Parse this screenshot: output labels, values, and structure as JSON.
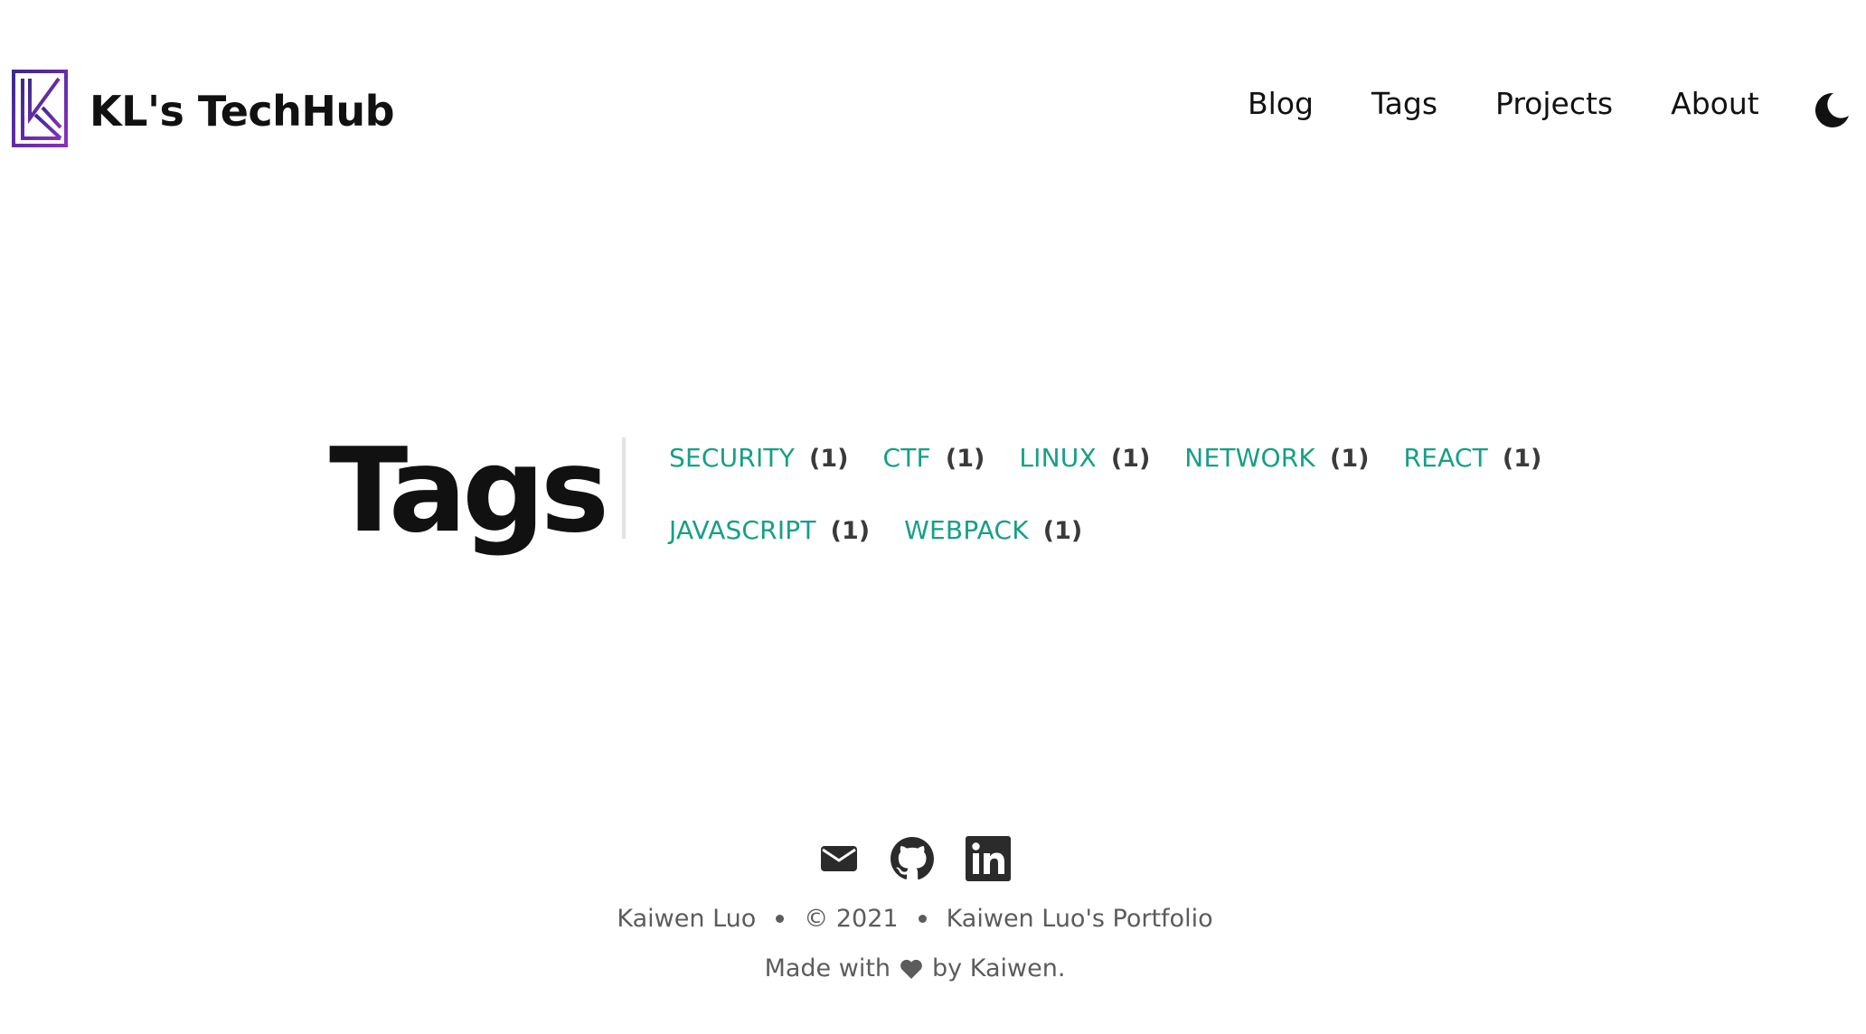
{
  "site": {
    "title": "KL's TechHub"
  },
  "nav": {
    "items": [
      {
        "label": "Blog"
      },
      {
        "label": "Tags"
      },
      {
        "label": "Projects"
      },
      {
        "label": "About"
      }
    ],
    "theme_toggle_icon": "moon-icon"
  },
  "page": {
    "heading": "Tags"
  },
  "tags": [
    {
      "name": "SECURITY",
      "count": "(1)"
    },
    {
      "name": "CTF",
      "count": "(1)"
    },
    {
      "name": "LINUX",
      "count": "(1)"
    },
    {
      "name": "NETWORK",
      "count": "(1)"
    },
    {
      "name": "REACT",
      "count": "(1)"
    },
    {
      "name": "JAVASCRIPT",
      "count": "(1)"
    },
    {
      "name": "WEBPACK",
      "count": "(1)"
    }
  ],
  "footer": {
    "social_icons": [
      "mail-icon",
      "github-icon",
      "linkedin-icon"
    ],
    "author": "Kaiwen Luo",
    "copyright": "© 2021",
    "site_name": "Kaiwen Luo's Portfolio",
    "made_with_prefix": "Made with",
    "made_with_suffix": "by Kaiwen."
  },
  "colors": {
    "accent": "#14a085",
    "logo_gradient_start": "#3b2a8f",
    "logo_gradient_end": "#8a2fb8",
    "text": "#111111",
    "muted": "#5c5c5c"
  }
}
